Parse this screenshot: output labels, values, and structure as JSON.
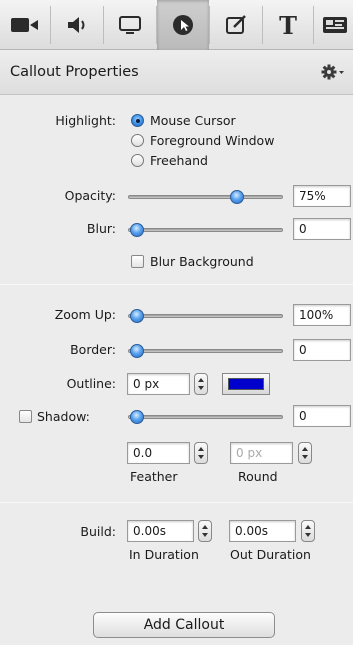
{
  "toolbar": {
    "items": [
      {
        "name": "video-camera-icon"
      },
      {
        "name": "audio-speaker-icon"
      },
      {
        "name": "screen-icon"
      },
      {
        "name": "callout-cursor-icon",
        "active": true
      },
      {
        "name": "annotation-icon"
      },
      {
        "name": "text-icon",
        "glyph": "T"
      },
      {
        "name": "effects-icon"
      }
    ]
  },
  "panel": {
    "title": "Callout Properties",
    "gear_icon": "gear-icon"
  },
  "highlight": {
    "label": "Highlight:",
    "options": [
      "Mouse Cursor",
      "Foreground Window",
      "Freehand"
    ],
    "selected": "Mouse Cursor"
  },
  "opacity": {
    "label": "Opacity:",
    "value": "75%",
    "level": 0.75
  },
  "blur": {
    "label": "Blur:",
    "value": "0",
    "level": 0
  },
  "blur_background": {
    "label": "Blur Background",
    "checked": false
  },
  "zoom_up": {
    "label": "Zoom Up:",
    "value": "100%",
    "level": 0
  },
  "border": {
    "label": "Border:",
    "value": "0",
    "level": 0
  },
  "outline": {
    "label": "Outline:",
    "value": "0 px",
    "color": "#0000cc"
  },
  "shadow": {
    "label": "Shadow:",
    "checked": false,
    "value": "0",
    "level": 0
  },
  "feather": {
    "label": "Feather",
    "value": "0.0"
  },
  "round": {
    "label": "Round",
    "value": "0 px"
  },
  "build": {
    "label": "Build:",
    "in_value": "0.00s",
    "in_label": "In Duration",
    "out_value": "0.00s",
    "out_label": "Out Duration"
  },
  "add_button": {
    "label": "Add Callout"
  }
}
